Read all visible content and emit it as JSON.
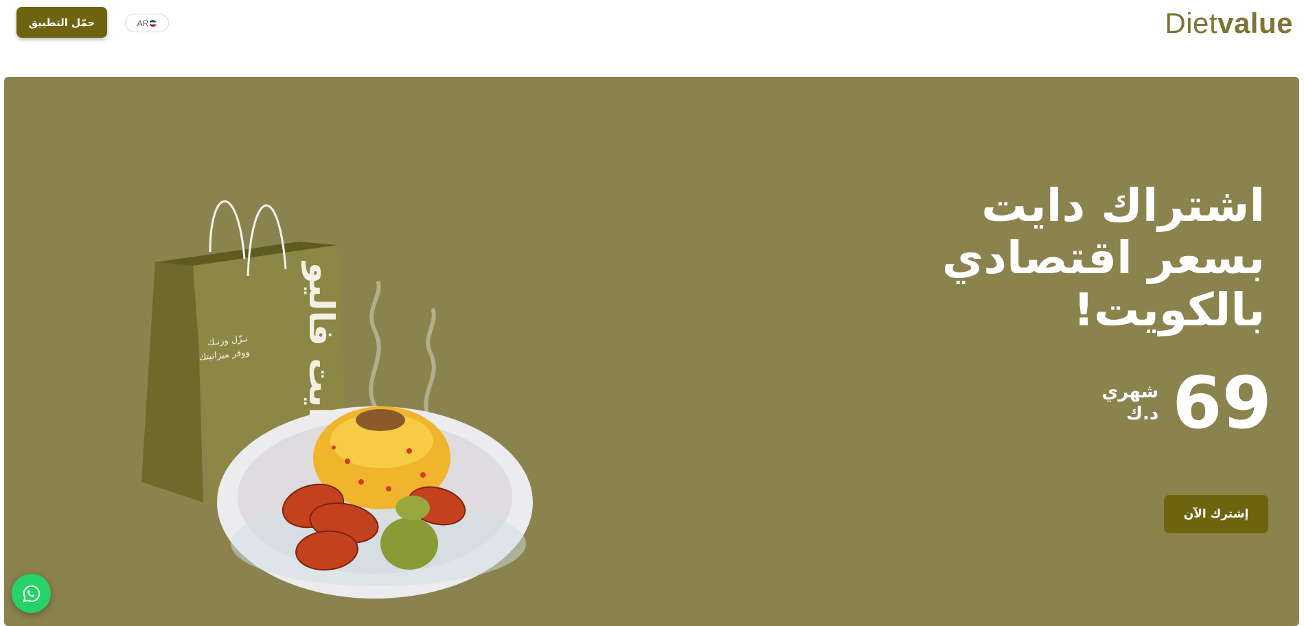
{
  "header": {
    "download_label": "حمّل التطبيق",
    "language_label": "AR",
    "language_flag_icon": "kuwait-flag-icon",
    "logo_light": "Diet",
    "logo_bold": "value"
  },
  "hero": {
    "headline_lines": [
      "اشتراك دايت",
      "بسعر اقتصادي",
      "بالكويت!"
    ],
    "price_value": "69",
    "price_period": "شهري",
    "price_currency": "د.ك",
    "subscribe_label": "إشترك الآن",
    "bag_tagline": [
      "نـزّل وزنـك",
      "ووفر ميزانيتك"
    ],
    "bag_brand": "دايت فاليو",
    "image_icon": "food-bag-and-plate-illustration"
  },
  "colors": {
    "brand_dark": "#6e6410",
    "hero_background": "#8a834e",
    "logo": "#7d7535",
    "whatsapp": "#25d366"
  },
  "floating": {
    "whatsapp_icon": "whatsapp-icon"
  }
}
